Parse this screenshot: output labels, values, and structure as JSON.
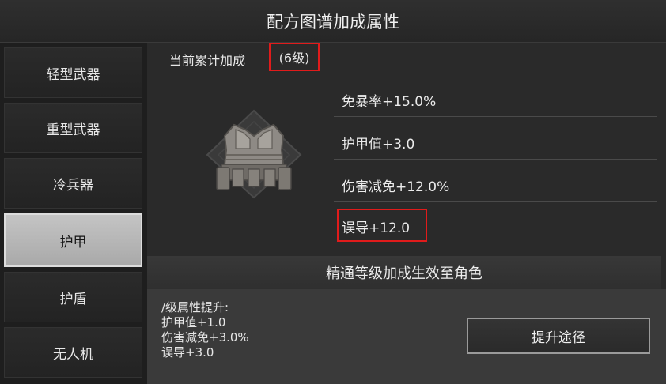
{
  "title": "配方图谱加成属性",
  "sidebar": {
    "items": [
      {
        "label": "轻型武器"
      },
      {
        "label": "重型武器"
      },
      {
        "label": "冷兵器"
      },
      {
        "label": "护甲"
      },
      {
        "label": "护盾"
      },
      {
        "label": "无人机"
      }
    ],
    "active_index": 3
  },
  "cumulative": {
    "label": "当前累计加成",
    "level": "(6级)"
  },
  "item_icon": "armor-vest-icon",
  "stats": [
    {
      "text": "免暴率+15.0%"
    },
    {
      "text": "护甲值+3.0"
    },
    {
      "text": "伤害减免+12.0%"
    },
    {
      "text": "误导+12.0"
    }
  ],
  "mastery_banner": "精通等级加成生效至角色",
  "per_level": {
    "title": "/级属性提升:",
    "lines": [
      "护甲值+1.0",
      "伤害减免+3.0%",
      "误导+3.0"
    ]
  },
  "upgrade_button": "提升途径",
  "colors": {
    "highlight": "#e01b1b",
    "active_tab": "#b8b8b8"
  }
}
